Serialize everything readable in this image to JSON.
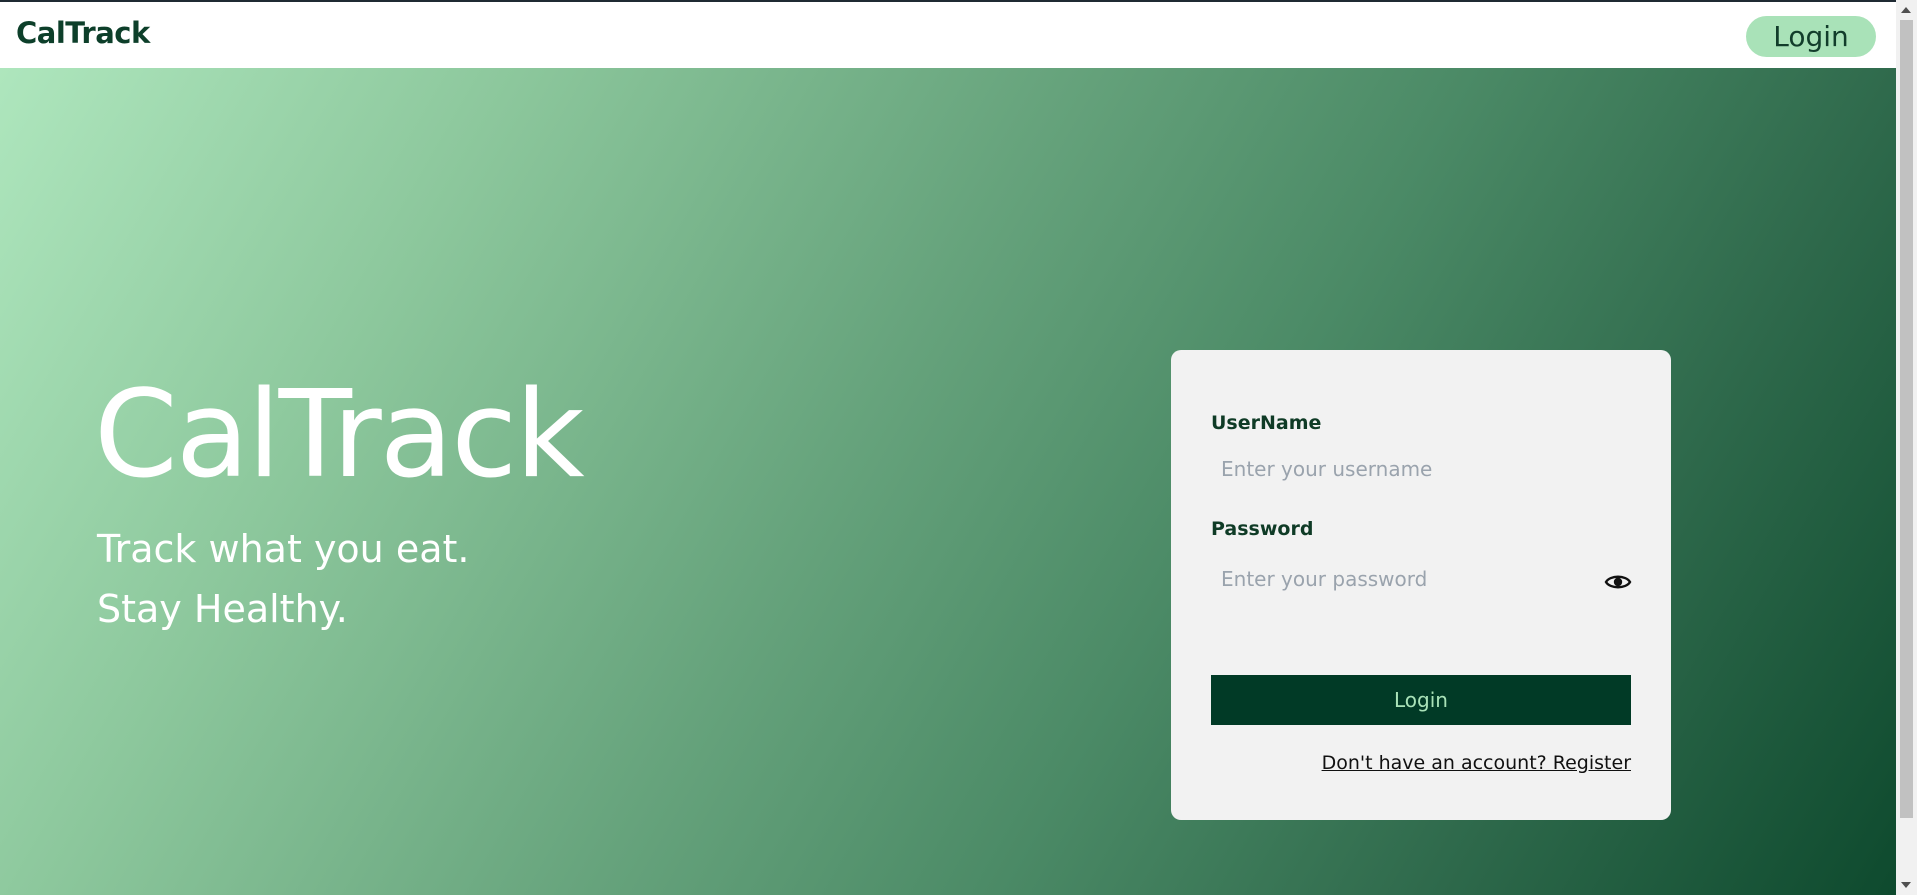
{
  "navbar": {
    "brand": "CalTrack",
    "login_button": "Login"
  },
  "hero": {
    "title": "CalTrack",
    "subtitle_line1": "Track what you eat.",
    "subtitle_line2": "Stay Healthy."
  },
  "login_form": {
    "username_label": "UserName",
    "username_placeholder": "Enter your username",
    "password_label": "Password",
    "password_placeholder": "Enter your password",
    "password_toggle_icon": "eye-icon",
    "submit_label": "Login",
    "register_link": "Don't have an account? Register"
  },
  "colors": {
    "brand_dark": "#013a26",
    "accent_light": "#a9e2b8",
    "card_bg": "#f2f2f2"
  }
}
